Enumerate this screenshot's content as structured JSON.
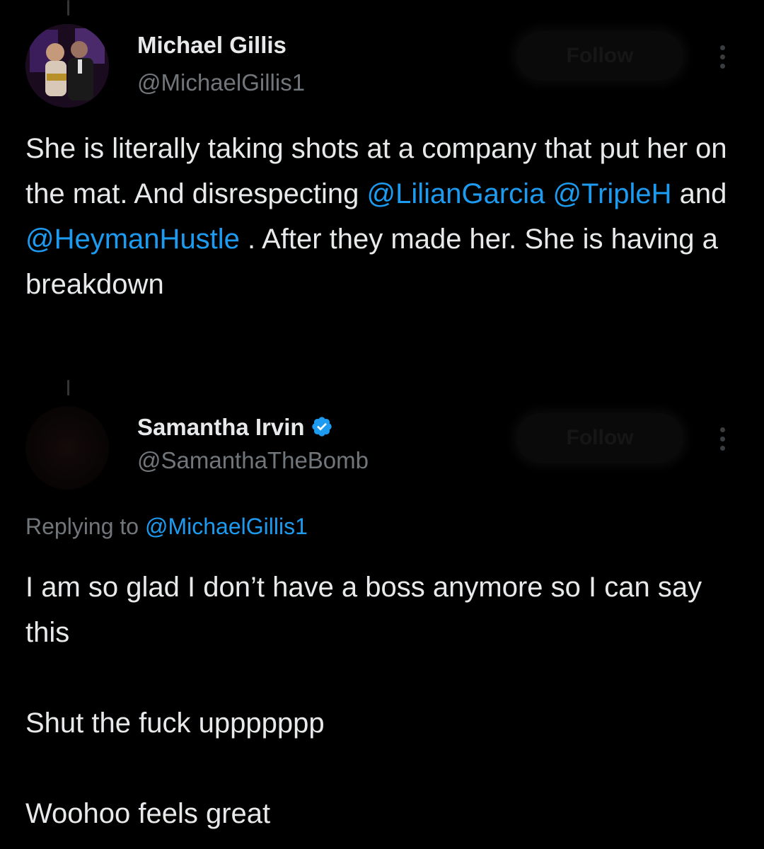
{
  "tweet1": {
    "author_name": "Michael Gillis",
    "author_handle": "@MichaelGillis1",
    "follow_label": "Follow",
    "text_a": "She is literally taking shots at a company that put her on the mat. And disrespecting ",
    "mention_1": "@LilianGarcia",
    "mention_2": "@TripleH",
    "text_b": " and ",
    "mention_3": "@HeymanHustle",
    "text_c": " . After they made her. She is having a breakdown"
  },
  "tweet2": {
    "author_name": "Samantha Irvin",
    "author_handle": "@SamanthaTheBomb",
    "verified": true,
    "follow_label": "Follow",
    "replying_prefix": "Replying to ",
    "replying_mention": "@MichaelGillis1",
    "paragraph_1": "I am so glad I don’t have a boss anymore so I can say this",
    "paragraph_2": "Shut the fuck uppppppp",
    "paragraph_3": "Woohoo feels great"
  },
  "colors": {
    "background": "#000000",
    "text_primary": "#e7e9ea",
    "text_secondary": "#71767b",
    "link": "#1d9bf0",
    "verified_badge": "#1d9bf0"
  },
  "icons": {
    "verified": "verified-badge-icon",
    "more": "more-options-icon"
  }
}
